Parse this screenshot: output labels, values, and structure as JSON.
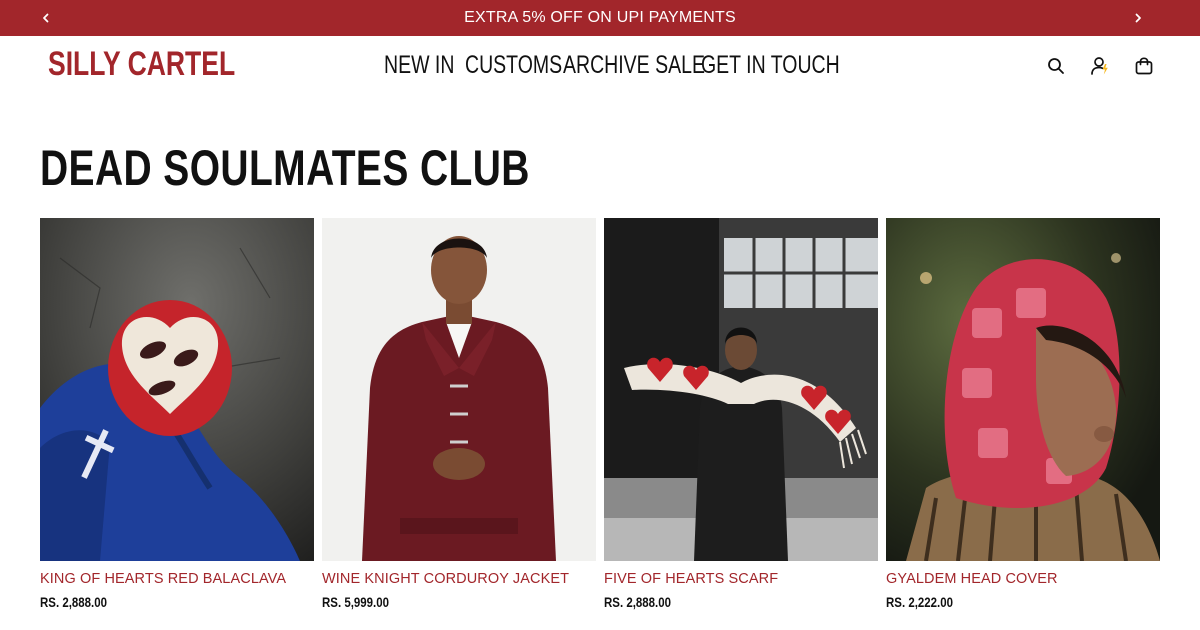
{
  "announcement": {
    "text": "EXTRA 5% OFF ON UPI PAYMENTS",
    "prev_icon": "chevron-left-icon",
    "next_icon": "chevron-right-icon"
  },
  "header": {
    "logo": "SILLY CARTEL",
    "nav": [
      {
        "label": "NEW IN"
      },
      {
        "label": "CUSTOMS"
      },
      {
        "label": "ARCHIVE SALE"
      },
      {
        "label": "GET IN TOUCH"
      }
    ],
    "icons": [
      "search-icon",
      "account-icon",
      "bag-icon"
    ]
  },
  "collection": {
    "title": "DEAD SOULMATES CLUB"
  },
  "products": [
    {
      "name": "KING OF HEARTS RED BALACLAVA",
      "price": "RS. 2,888.00"
    },
    {
      "name": "WINE KNIGHT CORDUROY JACKET",
      "price": "RS. 5,999.00"
    },
    {
      "name": "FIVE OF HEARTS SCARF",
      "price": "RS. 2,888.00"
    },
    {
      "name": "GYALDEM HEAD COVER",
      "price": "RS. 2,222.00"
    }
  ],
  "colors": {
    "brand": "#a2262b",
    "text": "#111111",
    "background": "#ffffff"
  }
}
